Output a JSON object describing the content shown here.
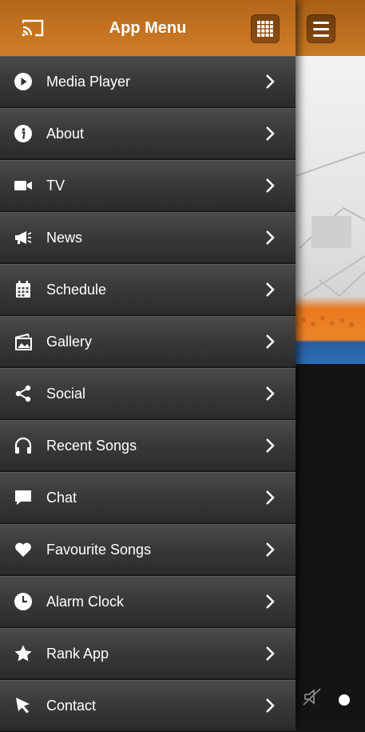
{
  "drawer": {
    "title": "App Menu",
    "cast_icon": "cast-icon",
    "grid_icon": "grid-icon"
  },
  "menu": [
    {
      "label": "Media Player",
      "icon": "play-icon"
    },
    {
      "label": "About",
      "icon": "info-icon"
    },
    {
      "label": "TV",
      "icon": "video-camera-icon"
    },
    {
      "label": "News",
      "icon": "megaphone-icon"
    },
    {
      "label": "Schedule",
      "icon": "calendar-icon"
    },
    {
      "label": "Gallery",
      "icon": "photo-gallery-icon"
    },
    {
      "label": "Social",
      "icon": "share-icon"
    },
    {
      "label": "Recent Songs",
      "icon": "headphones-icon"
    },
    {
      "label": "Chat",
      "icon": "chat-bubble-icon"
    },
    {
      "label": "Favourite Songs",
      "icon": "heart-icon"
    },
    {
      "label": "Alarm Clock",
      "icon": "clock-icon"
    },
    {
      "label": "Rank App",
      "icon": "star-icon"
    },
    {
      "label": "Contact",
      "icon": "cursor-icon"
    }
  ],
  "background_app": {
    "menu_icon": "hamburger-menu-icon",
    "mute_icon": "speaker-muted-icon"
  },
  "colors": {
    "header_accent": "#c47522",
    "button_dark": "#7a430f",
    "row_top": "#4a4a4a",
    "row_bottom": "#2b2b2b"
  }
}
